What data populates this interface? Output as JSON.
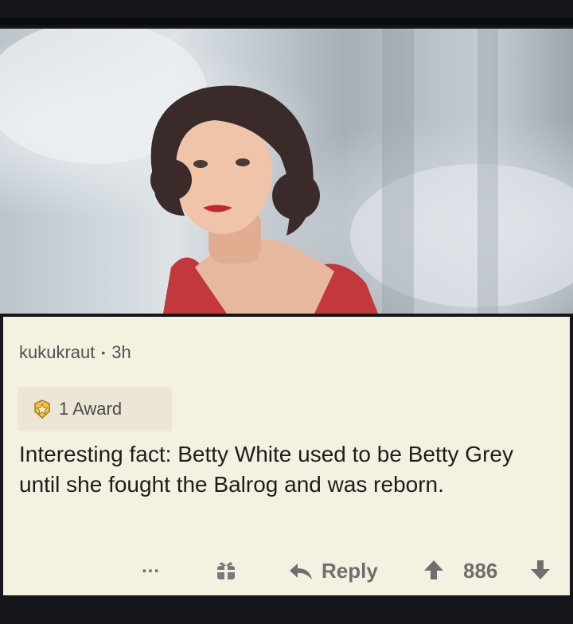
{
  "comment": {
    "username": "kukukraut",
    "separator": "•",
    "age": "3h",
    "award_label": "1 Award",
    "body": "Interesting fact: Betty White used to be Betty Grey until she fought the Balrog and was reborn.",
    "actions": {
      "more": "...",
      "reply": "Reply",
      "vote_count": "886"
    }
  },
  "icons": {
    "award": "award-medal-icon",
    "gift": "gift-icon",
    "reply": "reply-arrow-icon",
    "upvote": "upvote-arrow-icon",
    "downvote": "downvote-arrow-icon"
  },
  "colors": {
    "card_bg": "#f5f1e1",
    "text": "#1d1d1d",
    "meta": "#505050",
    "action": "#6f6f6f",
    "award_gold": "#d4a83a"
  }
}
